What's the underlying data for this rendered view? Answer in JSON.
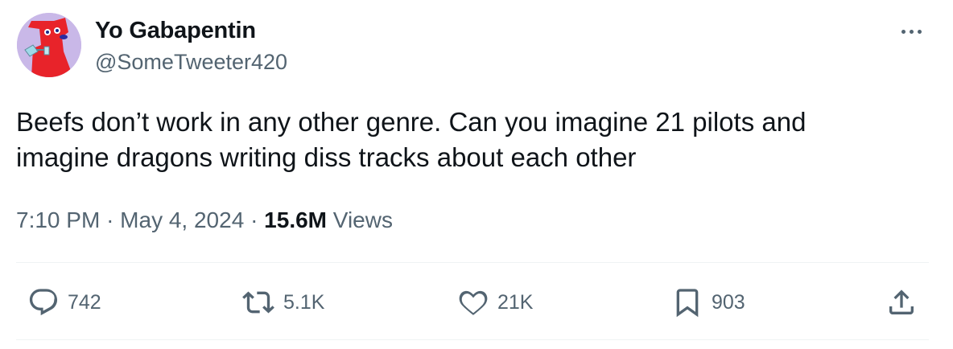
{
  "author": {
    "display_name": "Yo Gabapentin",
    "handle": "@SomeTweeter420",
    "avatar_icon": "red-dog-avatar-icon"
  },
  "tweet": {
    "line1": "Beefs don’t work in any other genre. Can you imagine 21 pilots and",
    "line2": "imagine dragons writing diss tracks about each other",
    "time": "7:10 PM",
    "date": "May 4, 2024",
    "views_count": "15.6M",
    "views_label": "Views"
  },
  "actions": {
    "replies": "742",
    "retweets": "5.1K",
    "likes": "21K",
    "bookmarks": "903"
  },
  "colors": {
    "text": "#0f1419",
    "secondary": "#536471",
    "divider": "#eff3f4",
    "avatar_bg": "#c9b8e8"
  }
}
